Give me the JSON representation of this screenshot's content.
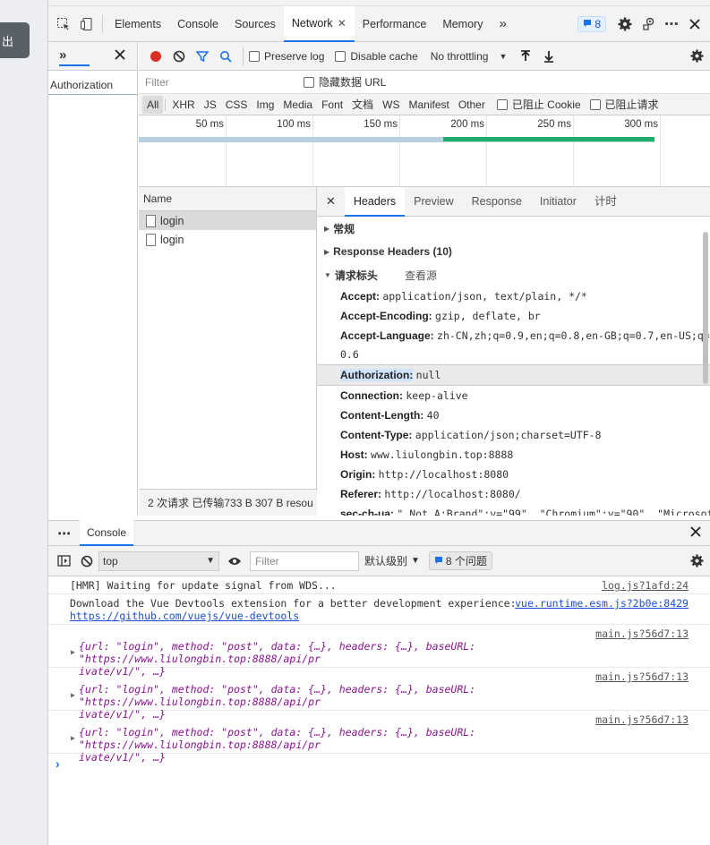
{
  "page": {
    "button_label": "出"
  },
  "devtools": {
    "tabs": [
      "Elements",
      "Console",
      "Sources",
      "Network",
      "Performance",
      "Memory"
    ],
    "active_tab": "Network",
    "more_tabs": "»",
    "issues_badge": "8"
  },
  "left_panel": {
    "more": "»",
    "item": "Authorization"
  },
  "network": {
    "preserve_log": "Preserve log",
    "disable_cache": "Disable cache",
    "throttling": "No throttling",
    "filter_placeholder": "Filter",
    "hide_data_urls": "隐藏数据 URL",
    "types": [
      "All",
      "XHR",
      "JS",
      "CSS",
      "Img",
      "Media",
      "Font",
      "文档",
      "WS",
      "Manifest",
      "Other"
    ],
    "blocked_cookies": "已阻止 Cookie",
    "blocked_requests": "已阻止请求",
    "timeline_ticks": [
      "50 ms",
      "100 ms",
      "150 ms",
      "200 ms",
      "250 ms",
      "300 ms"
    ],
    "list_header": "Name",
    "requests": [
      "login",
      "login"
    ],
    "status_bar": "2 次请求  已传输733 B  307 B resou"
  },
  "headers_panel": {
    "tabs": [
      "Headers",
      "Preview",
      "Response",
      "Initiator",
      "计时"
    ],
    "general": "常规",
    "response_headers": "Response Headers (10)",
    "request_headers": "请求标头",
    "view_source": "查看源",
    "items": [
      {
        "k": "Accept:",
        "v": "application/json, text/plain, */*"
      },
      {
        "k": "Accept-Encoding:",
        "v": "gzip, deflate, br"
      },
      {
        "k": "Accept-Language:",
        "v": "zh-CN,zh;q=0.9,en;q=0.8,en-GB;q=0.7,en-US;q=",
        "v2": "0.6"
      },
      {
        "k": "Authorization:",
        "v": "null"
      },
      {
        "k": "Connection:",
        "v": "keep-alive"
      },
      {
        "k": "Content-Length:",
        "v": "40"
      },
      {
        "k": "Content-Type:",
        "v": "application/json;charset=UTF-8"
      },
      {
        "k": "Host:",
        "v": "www.liulongbin.top:8888"
      },
      {
        "k": "Origin:",
        "v": "http://localhost:8080"
      },
      {
        "k": "Referer:",
        "v": "http://localhost:8080/"
      },
      {
        "k": "sec-ch-ua:",
        "v": "\" Not A;Brand\";v=\"99\", \"Chromium\";v=\"90\", \"Microsof"
      }
    ]
  },
  "console": {
    "drawer_more": "⋯",
    "drawer_tab": "Console",
    "context": "top",
    "filter_placeholder": "Filter",
    "levels": "默认级别",
    "issues": "8 个问题",
    "messages": [
      {
        "text": "[HMR] Waiting for update signal from WDS...",
        "source": "log.js?1afd:24"
      },
      {
        "text": "Download the Vue Devtools extension for a better development experience:",
        "link": "https://github.com/vuejs/vue-devtools",
        "source": "vue.runtime.esm.js?2b0e:8429"
      },
      {
        "source": "main.js?56d7:13",
        "line1": "{url: \"login\", method: \"post\", data: {…}, headers: {…}, baseURL: \"https://www.liulongbin.top:8888/api/pr",
        "line2": "ivate/v1/\", …}"
      },
      {
        "source": "main.js?56d7:13",
        "line1": "{url: \"login\", method: \"post\", data: {…}, headers: {…}, baseURL: \"https://www.liulongbin.top:8888/api/pr",
        "line2": "ivate/v1/\", …}"
      },
      {
        "source": "main.js?56d7:13",
        "line1": "{url: \"login\", method: \"post\", data: {…}, headers: {…}, baseURL: \"https://www.liulongbin.top:8888/api/pr",
        "line2": "ivate/v1/\", …}"
      }
    ],
    "prompt": "›"
  },
  "colors": {
    "accent": "#1a73e8",
    "record": "#d93025",
    "timing_bar": "#1fad6b",
    "waiting_bar": "#b7cfe0"
  }
}
